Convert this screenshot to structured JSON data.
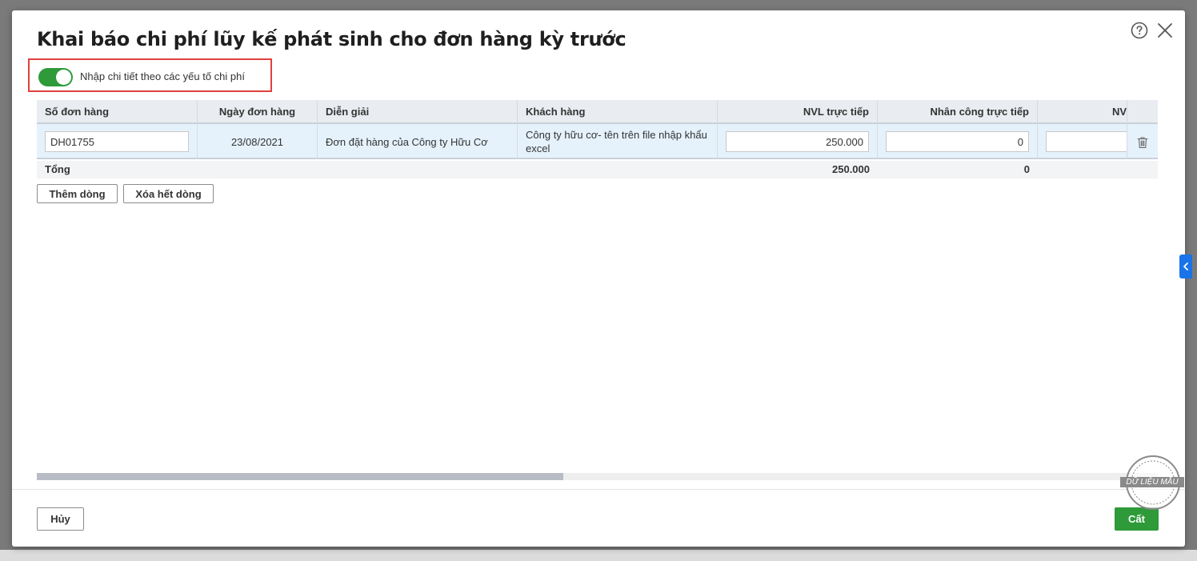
{
  "dialog": {
    "title": "Khai báo chi phí lũy kế phát sinh cho đơn hàng kỳ trước",
    "toggle_label": "Nhập chi tiết theo các yếu tố chi phí",
    "toggle_on": true
  },
  "table": {
    "columns": [
      "Số đơn hàng",
      "Ngày đơn hàng",
      "Diễn giải",
      "Khách hàng",
      "NVL trực tiếp",
      "Nhân công trực tiếp",
      "NV"
    ],
    "rows": [
      {
        "order_no": "DH01755",
        "order_date": "23/08/2021",
        "description": "Đơn đặt hàng của Công ty Hữu Cơ",
        "customer": "Công ty hữu cơ- tên trên file nhập khẩu excel",
        "nvl": "250.000",
        "labor": "0",
        "nv": ""
      }
    ],
    "total_label": "Tổng",
    "total_nvl": "250.000",
    "total_labor": "0"
  },
  "buttons": {
    "add_row": "Thêm dòng",
    "delete_all": "Xóa hết dòng",
    "cancel": "Hủy",
    "save": "Cất"
  },
  "scrollbar": {
    "visible_fraction": 0.47
  },
  "watermark": "DỮ LIỆU MẪU",
  "colors": {
    "accent_green": "#2e9a3a",
    "highlight_border": "#e0403a",
    "selected_row": "#e5f2fc",
    "side_tab_blue": "#1a73e8"
  }
}
